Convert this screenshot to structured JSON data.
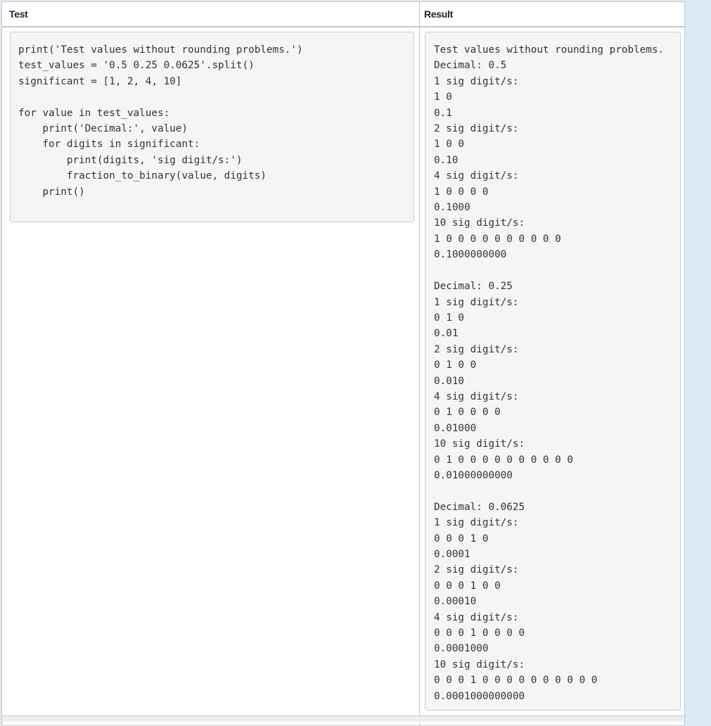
{
  "table": {
    "headers": {
      "test": "Test",
      "result": "Result"
    },
    "test_code": "print('Test values without rounding problems.')\ntest_values = '0.5 0.25 0.0625'.split()\nsignificant = [1, 2, 4, 10]\n\nfor value in test_values:\n    print('Decimal:', value)\n    for digits in significant:\n        print(digits, 'sig digit/s:')\n        fraction_to_binary(value, digits)\n    print()",
    "result_output": "Test values without rounding problems.\nDecimal: 0.5\n1 sig digit/s:\n1 0\n0.1\n2 sig digit/s:\n1 0 0\n0.10\n4 sig digit/s:\n1 0 0 0 0\n0.1000\n10 sig digit/s:\n1 0 0 0 0 0 0 0 0 0 0\n0.1000000000\n\nDecimal: 0.25\n1 sig digit/s:\n0 1 0\n0.01\n2 sig digit/s:\n0 1 0 0\n0.010\n4 sig digit/s:\n0 1 0 0 0 0\n0.01000\n10 sig digit/s:\n0 1 0 0 0 0 0 0 0 0 0 0\n0.01000000000\n\nDecimal: 0.0625\n1 sig digit/s:\n0 0 0 1 0\n0.0001\n2 sig digit/s:\n0 0 0 1 0 0\n0.00010\n4 sig digit/s:\n0 0 0 1 0 0 0 0\n0.0001000\n10 sig digit/s:\n0 0 0 1 0 0 0 0 0 0 0 0 0 0\n0.0001000000000"
  }
}
